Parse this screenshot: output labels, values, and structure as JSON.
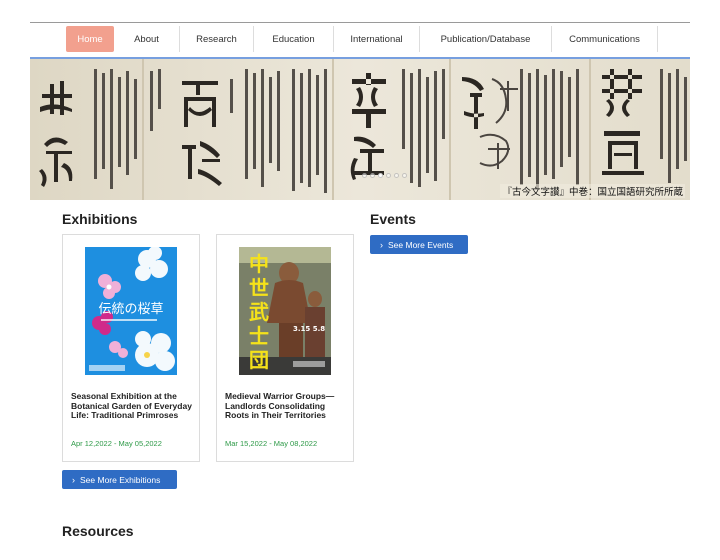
{
  "nav": {
    "items": [
      {
        "label": "Home",
        "active": true
      },
      {
        "label": "About"
      },
      {
        "label": "Research"
      },
      {
        "label": "Education"
      },
      {
        "label": "International"
      },
      {
        "label": "Publication/Database"
      },
      {
        "label": "Communications"
      }
    ]
  },
  "hero": {
    "caption": "『古今文字讃』中巻：国立国語研究所所蔵",
    "slide_count": 6,
    "active_slide": 3
  },
  "exhibitions": {
    "heading": "Exhibitions",
    "cards": [
      {
        "title": "Seasonal Exhibition at the Botanical Garden of Everyday Life: Traditional Primroses",
        "date": "Apr 12,2022 - May 05,2022",
        "poster_text": "伝統の桜草",
        "poster_color": "#1e8fe0"
      },
      {
        "title": "Medieval Warrior Groups—Landlords Consolidating Roots in Their Territories",
        "date": "Mar 15,2022 - May 08,2022",
        "poster_text": "中世武士団",
        "poster_dates": "3.15 5.8",
        "poster_color": "#f5e21a"
      }
    ],
    "more_label": "See More Exhibitions"
  },
  "events": {
    "heading": "Events",
    "more_label": "See More Events"
  },
  "resources": {
    "heading": "Resources"
  },
  "colors": {
    "accent": "#2f6cc4",
    "nav_active": "#f2a08e",
    "date_green": "#2e9a48"
  }
}
